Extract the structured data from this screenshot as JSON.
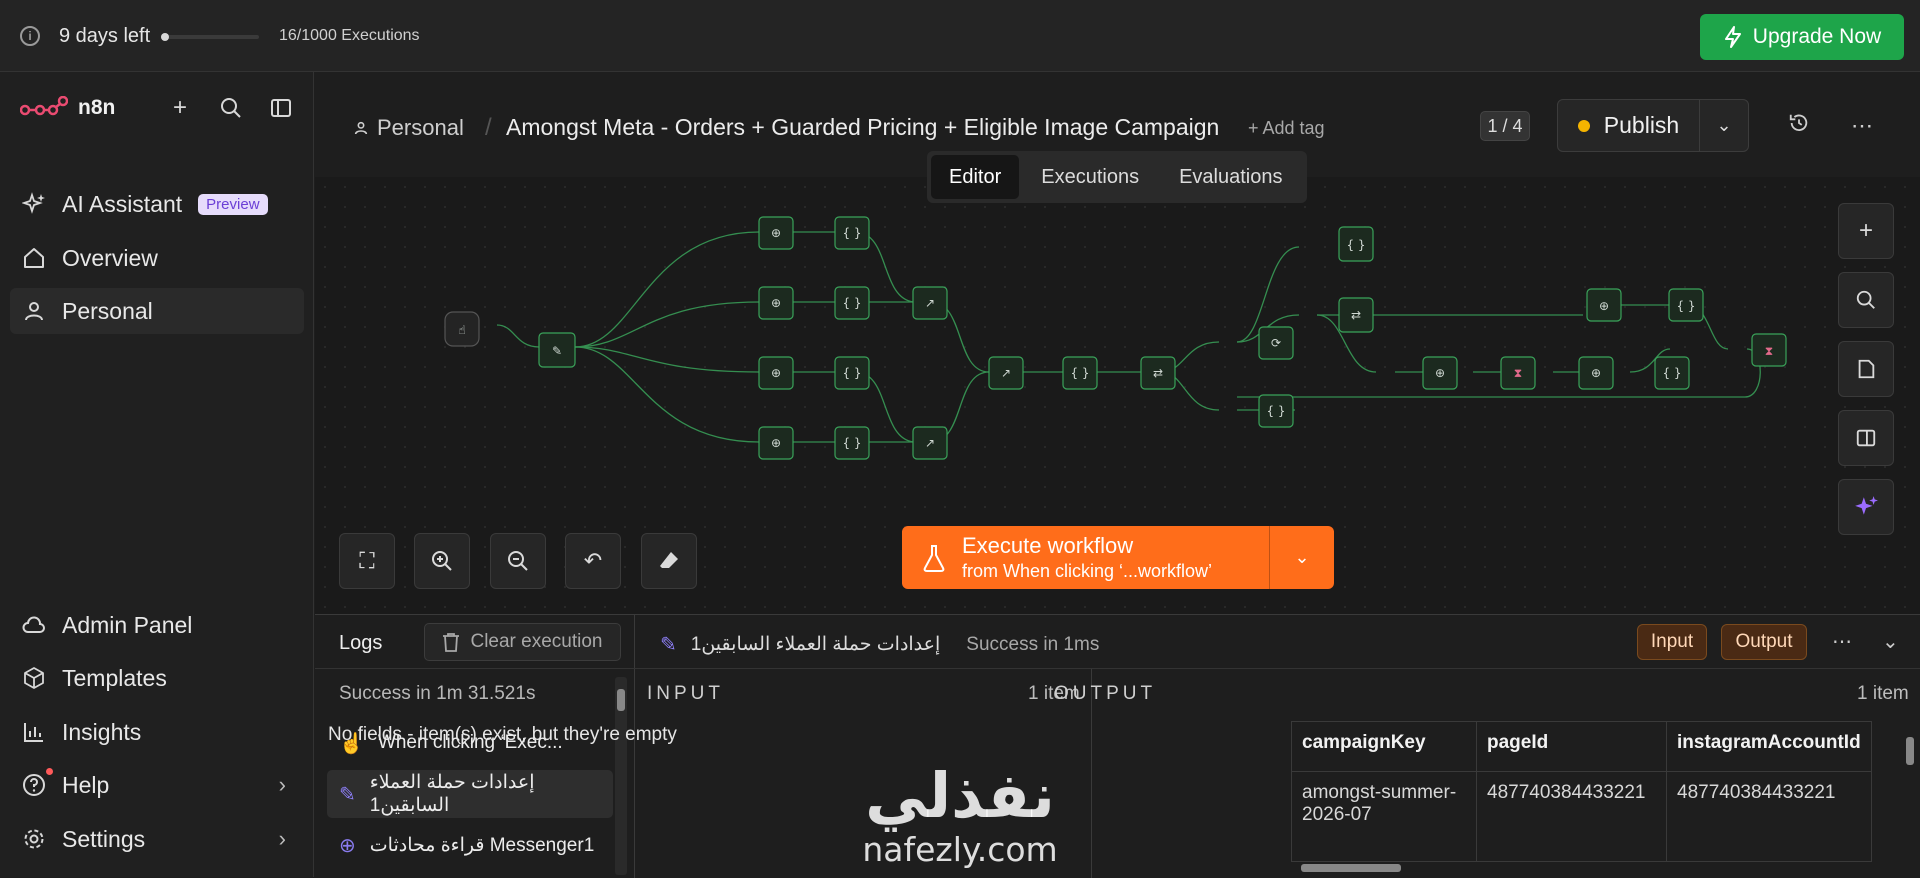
{
  "trial": {
    "days_left": "9 days left",
    "executions": "16/1000 Executions",
    "progress": 0.016
  },
  "upgrade": {
    "label": "Upgrade Now",
    "icon": "lightning-icon",
    "color": "#1ea54a"
  },
  "sidebar": {
    "logo_text": "n8n",
    "items": [
      {
        "label": "AI Assistant",
        "badge": "Preview",
        "icon": "sparkles-icon"
      },
      {
        "label": "Overview",
        "icon": "home-icon"
      },
      {
        "label": "Personal",
        "icon": "user-icon"
      }
    ],
    "bottom_items": [
      {
        "label": "Admin Panel",
        "icon": "cloud-icon"
      },
      {
        "label": "Templates",
        "icon": "box-icon"
      },
      {
        "label": "Insights",
        "icon": "chart-icon"
      },
      {
        "label": "Help",
        "icon": "help-icon"
      },
      {
        "label": "Settings",
        "icon": "gear-icon"
      }
    ]
  },
  "header": {
    "project": "Personal",
    "title": "Amongst Meta - Orders + Guarded Pricing + Eligible Image Campaign",
    "add_tag": "+ Add tag",
    "version": "1 / 4",
    "publish": "Publish",
    "publish_status_color": "#f5b400"
  },
  "tabs": [
    "Editor",
    "Executions",
    "Evaluations"
  ],
  "canvas": {
    "execute_title": "Execute workflow",
    "execute_sub": "from When clicking ‘...workflow’",
    "accent": "#ff6d1a"
  },
  "logs": {
    "title": "Logs",
    "clear": "Clear execution",
    "run_status": "Success in 1m 31.521s",
    "entries": [
      {
        "label": "When clicking ‘Exec...",
        "icon": "pointer-icon"
      },
      {
        "label": "إعدادات حملة العملاء السابقين1",
        "icon": "edit-icon"
      },
      {
        "label": "قراءة محادثات Messenger1",
        "icon": "globe-icon"
      }
    ],
    "node_name": "إعدادات حملة العملاء السابقين1",
    "node_status": "Success in 1ms",
    "input_pill": "Input",
    "output_pill": "Output",
    "input_label": "INPUT",
    "input_count": "1 item",
    "input_empty": "No fields - item(s) exist, but they're empty",
    "output_label": "OUTPUT",
    "output_count": "1 item",
    "output_columns": [
      "campaignKey",
      "pageId",
      "instagramAccountId"
    ],
    "output_rows": [
      [
        "amongst-summer-2026-07",
        "487740384433221",
        "487740384433221"
      ]
    ]
  },
  "watermark": {
    "arabic": "نفذلي",
    "latin": "nafezly.com"
  }
}
